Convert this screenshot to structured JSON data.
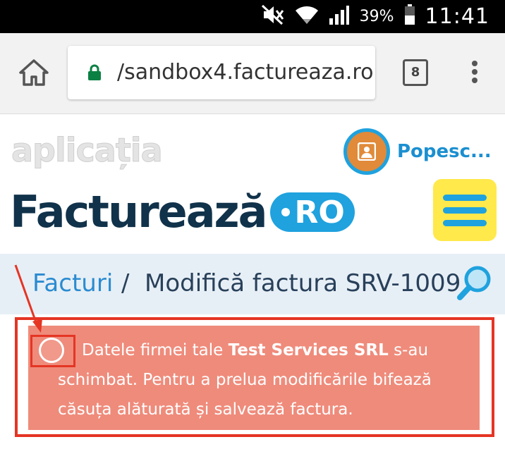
{
  "status_bar": {
    "battery_percent": "39%",
    "time": "11:41",
    "icons": [
      "mute-icon",
      "wifi-icon",
      "signal-icon",
      "battery-icon"
    ]
  },
  "browser": {
    "url": "/sandbox4.factureaza.ro",
    "tab_count": "8",
    "icons": [
      "home-icon",
      "lock-icon",
      "tabs-icon",
      "overflow-menu-icon"
    ]
  },
  "site": {
    "app_label": "aplicația",
    "brand_name": "Facturează",
    "brand_domain": "RO",
    "user_name": "Popesc...",
    "colors": {
      "brand_dark": "#10324a",
      "brand_blue": "#1fa2de",
      "menu_yellow": "#ffe94b",
      "alert_bg": "#ef8b7b",
      "annotation_red": "#e53524"
    }
  },
  "breadcrumb": {
    "parent": "Facturi",
    "separator": "/",
    "current": "Modifică factura SRV-1009"
  },
  "alert": {
    "text_before": "Datele firmei tale ",
    "company": "Test Services SRL",
    "text_after": " s-au schimbat. Pentru a prelua modificările bifează căsuța alăturată și salvează factura.",
    "checkbox_checked": false
  }
}
